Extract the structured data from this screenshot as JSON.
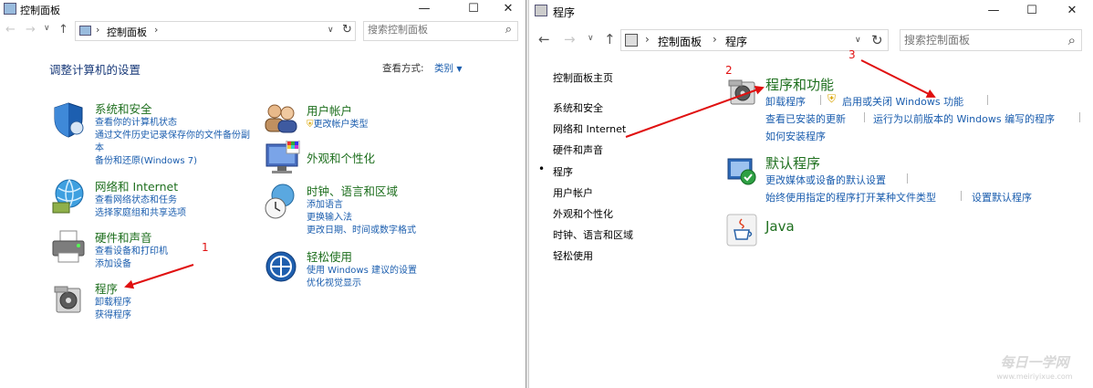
{
  "left": {
    "title": "控制面板",
    "controls": {
      "minimize": "—",
      "maximize": "☐",
      "close": "✕"
    },
    "address": {
      "crumb": "控制面板"
    },
    "search_placeholder": "搜索控制面板",
    "heading": "调整计算机的设置",
    "view_label": "查看方式:",
    "view_value": "类别",
    "categories": [
      {
        "title": "系统和安全",
        "links": [
          "查看你的计算机状态",
          "通过文件历史记录保存你的文件备份副",
          "本",
          "备份和还原(Windows 7)"
        ]
      },
      {
        "title": "网络和 Internet",
        "links": [
          "查看网络状态和任务",
          "选择家庭组和共享选项"
        ]
      },
      {
        "title": "硬件和声音",
        "links": [
          "查看设备和打印机",
          "添加设备"
        ]
      },
      {
        "title": "程序",
        "links": [
          "卸载程序",
          "获得程序"
        ]
      },
      {
        "title": "用户帐户",
        "links": [
          "更改帐户类型"
        ]
      },
      {
        "title": "外观和个性化",
        "links": []
      },
      {
        "title": "时钟、语言和区域",
        "links": [
          "添加语言",
          "更换输入法",
          "更改日期、时间或数字格式"
        ]
      },
      {
        "title": "轻松使用",
        "links": [
          "使用 Windows 建议的设置",
          "优化视觉显示"
        ]
      }
    ]
  },
  "right": {
    "title": "程序",
    "controls": {
      "minimize": "—",
      "maximize": "☐",
      "close": "✕"
    },
    "address": {
      "crumb1": "控制面板",
      "crumb2": "程序"
    },
    "search_placeholder": "搜索控制面板",
    "nav": [
      "控制面板主页",
      "系统和安全",
      "网络和 Internet",
      "硬件和声音",
      "程序",
      "用户帐户",
      "外观和个性化",
      "时钟、语言和区域",
      "轻松使用"
    ],
    "current_nav_bullet": "•",
    "sections": [
      {
        "title": "程序和功能",
        "links": [
          "卸载程序",
          "启用或关闭 Windows 功能",
          "查看已安装的更新",
          "运行为以前版本的 Windows 编写的程序",
          "如何安装程序"
        ]
      },
      {
        "title": "默认程序",
        "links": [
          "更改媒体或设备的默认设置",
          "始终使用指定的程序打开某种文件类型",
          "设置默认程序"
        ]
      },
      {
        "title": "Java",
        "links": []
      }
    ]
  },
  "annotations": [
    "1",
    "2",
    "3"
  ],
  "watermark": {
    "line1": "每日一学网",
    "line2": "www.meiriyixue.com"
  },
  "colors": {
    "category_green": "#1e6f1e",
    "link_blue": "#1a5dae",
    "arrow_red": "#e01010"
  }
}
